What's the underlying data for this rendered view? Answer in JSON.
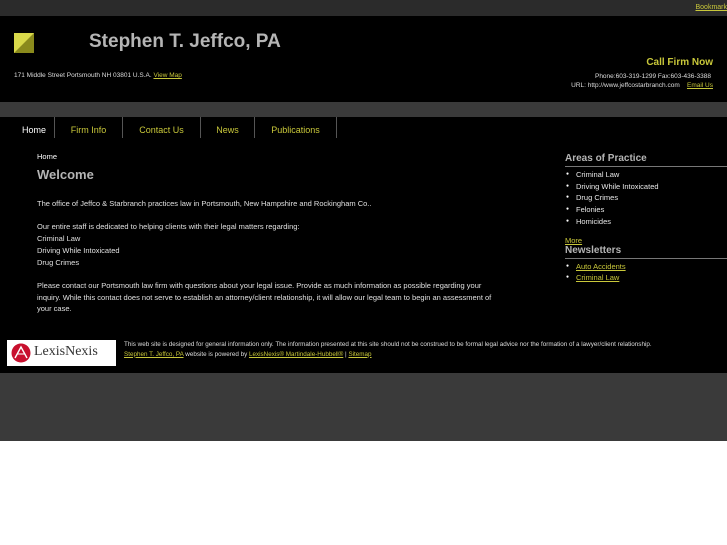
{
  "topbar": {
    "bookmark": "Bookmark"
  },
  "header": {
    "firm_name": "Stephen T. Jeffco, PA",
    "address": "171 Middle Street Portsmouth NH 03801 U.S.A.",
    "view_map": "View Map",
    "call_now": "Call Firm Now",
    "phone_fax": "Phone:603-319-1299    Fax:603-436-3388",
    "url_text": "URL: http://www.jeffcostarbranch.com",
    "email_us": "Email Us"
  },
  "nav": {
    "items": [
      "Home",
      "Firm Info",
      "Contact Us",
      "News",
      "Publications"
    ]
  },
  "main": {
    "breadcrumb": "Home",
    "heading": "Welcome",
    "para1": "The office of Jeffco & Starbranch practices law in Portsmouth, New Hampshire and Rockingham Co..",
    "para2": "Our entire staff is dedicated to helping clients with their legal matters regarding:",
    "matters": [
      "Criminal Law",
      "Driving While Intoxicated",
      "Drug Crimes"
    ],
    "para3": "Please contact our Portsmouth law firm with questions about your legal issue. Provide as much information as possible regarding your inquiry. While this contact does not serve to establish an attorney/client relationship, it will allow our legal team to begin an assessment of your case."
  },
  "sidebar": {
    "areas_heading": "Areas of Practice",
    "areas": [
      "Criminal Law",
      "Driving While Intoxicated",
      "Drug Crimes",
      "Felonies",
      "Homicides"
    ],
    "more": "More",
    "newsletters_heading": "Newsletters",
    "newsletters": [
      "Auto Accidents",
      "Criminal Law"
    ]
  },
  "footer": {
    "logo_text": "LexisNexis",
    "disclaimer": "This web site is designed for general information only. The information presented at this site should not be construed to be formal legal advice nor the formation of a lawyer/client relationship.",
    "firm_link": "Stephen T. Jeffco, PA",
    "powered_by": "website is powered by",
    "lexis_link": "LexisNexis® Martindale-Hubbell®",
    "separator": "|",
    "sitemap": "Sitemap"
  },
  "colors": {
    "accent": "#c9c83a",
    "background": "#000000",
    "bar": "#3a3a3a"
  }
}
